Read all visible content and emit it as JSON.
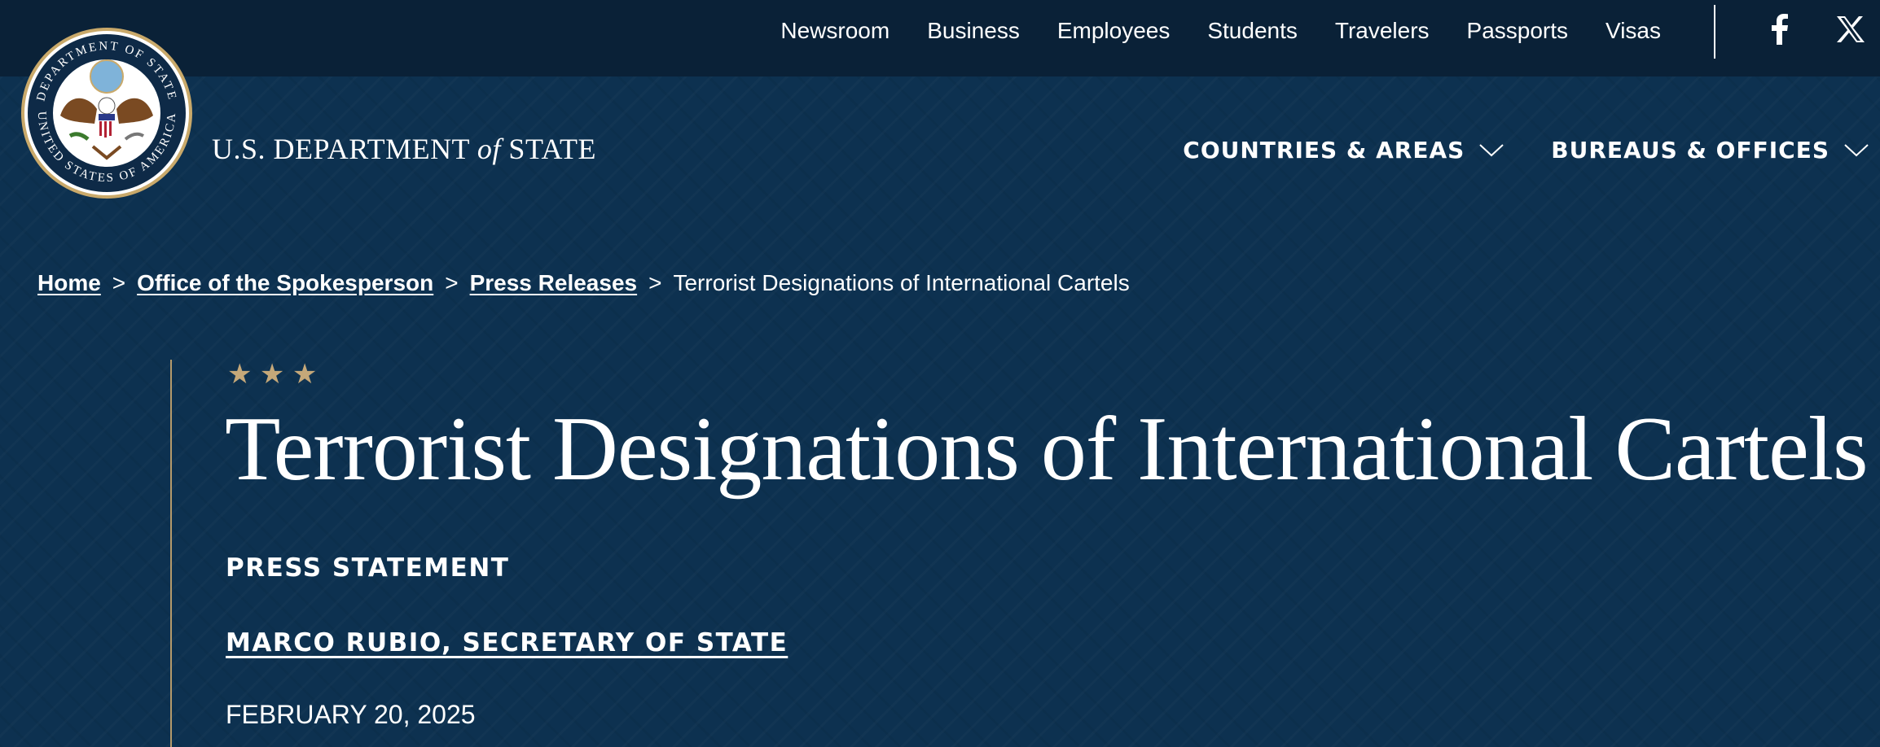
{
  "utility_nav": [
    "Newsroom",
    "Business",
    "Employees",
    "Students",
    "Travelers",
    "Passports",
    "Visas"
  ],
  "social": [
    {
      "icon": "facebook-icon"
    },
    {
      "icon": "x-icon"
    }
  ],
  "header": {
    "seal_text_top": "DEPARTMENT OF STATE",
    "seal_text_bottom": "UNITED STATES OF AMERICA",
    "site_name_pre": "U.S. DEPARTMENT",
    "site_name_of": "of",
    "site_name_post": "STATE"
  },
  "main_nav": [
    {
      "label": "COUNTRIES & AREAS",
      "icon": "chevron-down-icon"
    },
    {
      "label": "BUREAUS & OFFICES",
      "icon": "chevron-down-icon"
    }
  ],
  "breadcrumb": {
    "items": [
      "Home",
      "Office of the Spokesperson",
      "Press Releases"
    ],
    "current": "Terrorist Designations of International Cartels",
    "separator": ">"
  },
  "article": {
    "stars": "★ ★ ★",
    "title": "Terrorist Designations of International Cartels",
    "label": "PRESS STATEMENT",
    "author": "MARCO RUBIO, SECRETARY OF STATE",
    "date": "FEBRUARY 20, 2025"
  },
  "colors": {
    "header_bg": "#0a2137",
    "hero_bg": "#0d3150",
    "accent_gold": "#c5a879"
  }
}
